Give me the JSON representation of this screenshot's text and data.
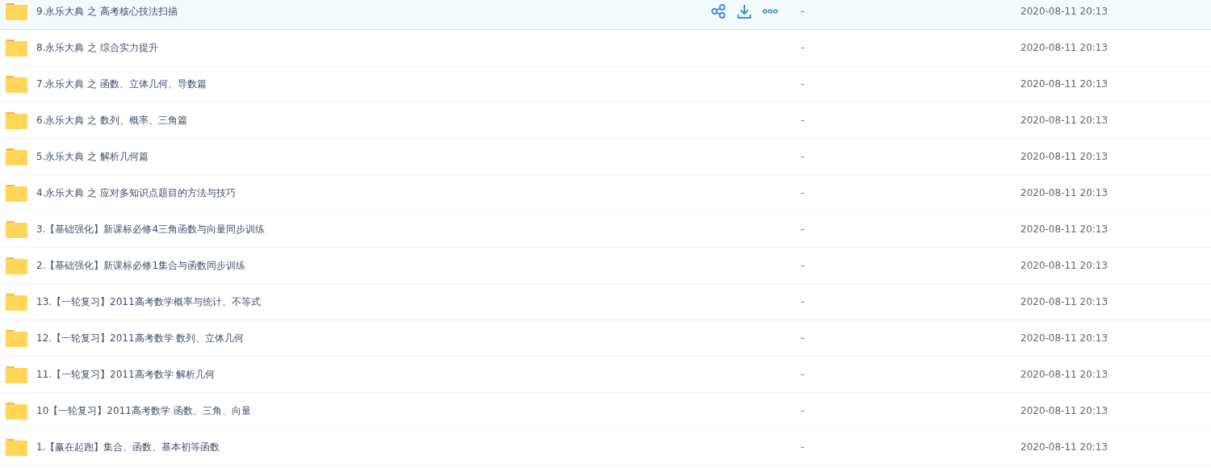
{
  "files": [
    {
      "name": "9.永乐大典 之 高考核心技法扫描",
      "size": "-",
      "modified": "2020-08-11 20:13",
      "hovered": true
    },
    {
      "name": "8.永乐大典 之 综合实力提升",
      "size": "-",
      "modified": "2020-08-11 20:13",
      "hovered": false
    },
    {
      "name": "7.永乐大典 之 函数、立体几何、导数篇",
      "size": "-",
      "modified": "2020-08-11 20:13",
      "hovered": false
    },
    {
      "name": "6.永乐大典 之 数列、概率、三角篇",
      "size": "-",
      "modified": "2020-08-11 20:13",
      "hovered": false
    },
    {
      "name": "5.永乐大典 之 解析几何篇",
      "size": "-",
      "modified": "2020-08-11 20:13",
      "hovered": false
    },
    {
      "name": "4.永乐大典 之 应对多知识点题目的方法与技巧",
      "size": "-",
      "modified": "2020-08-11 20:13",
      "hovered": false
    },
    {
      "name": "3.【基础强化】新课标必修4三角函数与向量同步训练",
      "size": "-",
      "modified": "2020-08-11 20:13",
      "hovered": false
    },
    {
      "name": "2.【基础强化】新课标必修1集合与函数同步训练",
      "size": "-",
      "modified": "2020-08-11 20:13",
      "hovered": false
    },
    {
      "name": "13.【一轮复习】2011高考数学概率与统计、不等式",
      "size": "-",
      "modified": "2020-08-11 20:13",
      "hovered": false
    },
    {
      "name": "12.【一轮复习】2011高考数学 数列、立体几何",
      "size": "-",
      "modified": "2020-08-11 20:13",
      "hovered": false
    },
    {
      "name": "11.【一轮复习】2011高考数学 解析几何",
      "size": "-",
      "modified": "2020-08-11 20:13",
      "hovered": false
    },
    {
      "name": "10【一轮复习】2011高考数学 函数、三角、向量",
      "size": "-",
      "modified": "2020-08-11 20:13",
      "hovered": false
    },
    {
      "name": "1.【赢在起跑】集合、函数、基本初等函数",
      "size": "-",
      "modified": "2020-08-11 20:13",
      "hovered": false
    }
  ]
}
